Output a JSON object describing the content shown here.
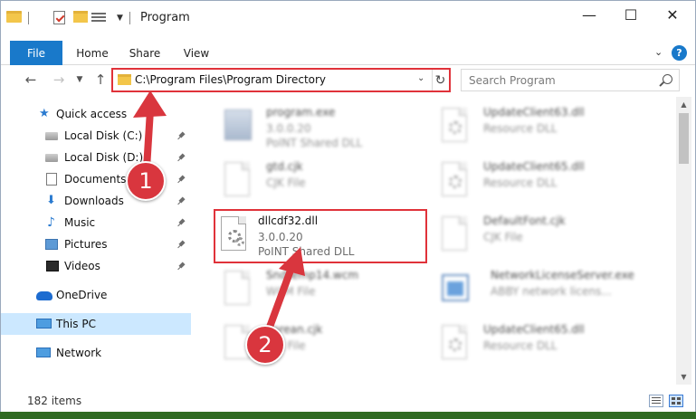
{
  "window": {
    "title": "Program",
    "controls": {
      "minimize": "—",
      "maximize": "☐",
      "close": "✕"
    }
  },
  "ribbon": {
    "tabs": [
      "File",
      "Home",
      "Share",
      "View"
    ],
    "help": "?"
  },
  "address": {
    "path": "C:\\Program Files\\Program Directory"
  },
  "search": {
    "placeholder": "Search Program"
  },
  "nav_pane": {
    "items": [
      {
        "label": "Quick access",
        "icon": "star-icon",
        "pinned": false
      },
      {
        "label": "Local Disk (C:)",
        "icon": "disk-icon",
        "pinned": true
      },
      {
        "label": "Local Disk (D:)",
        "icon": "disk-icon",
        "pinned": true
      },
      {
        "label": "Documents",
        "icon": "documents-icon",
        "pinned": true
      },
      {
        "label": "Downloads",
        "icon": "download-icon",
        "pinned": true
      },
      {
        "label": "Music",
        "icon": "music-icon",
        "pinned": true
      },
      {
        "label": "Pictures",
        "icon": "pictures-icon",
        "pinned": true
      },
      {
        "label": "Videos",
        "icon": "videos-icon",
        "pinned": true
      },
      {
        "label": "OneDrive",
        "icon": "onedrive-icon",
        "pinned": false
      },
      {
        "label": "This PC",
        "icon": "this-pc-icon",
        "pinned": false,
        "selected": true
      },
      {
        "label": "Network",
        "icon": "network-icon",
        "pinned": false
      }
    ]
  },
  "files": [
    {
      "name": "program.exe",
      "line2": "3.0.0.20",
      "line3": "PolNT Shared DLL",
      "icon": "application-icon",
      "blurred": true
    },
    {
      "name": "UpdateClient63.dll",
      "line2": "Resource DLL",
      "line3": "",
      "icon": "dll-file-icon",
      "blurred": true
    },
    {
      "name": "gtd.cjk",
      "line2": "CJK File",
      "line3": "",
      "icon": "blank-file-icon",
      "blurred": true
    },
    {
      "name": "UpdateClient65.dll",
      "line2": "Resource DLL",
      "line3": "",
      "icon": "dll-file-icon",
      "blurred": true
    },
    {
      "name": "dllcdf32.dll",
      "line2": "3.0.0.20",
      "line3": "PoINT Shared DLL",
      "icon": "dll-file-icon",
      "blurred": false,
      "highlighted": true
    },
    {
      "name": "DefaultFont.cjk",
      "line2": "CJK File",
      "line3": "",
      "icon": "blank-file-icon",
      "blurred": true
    },
    {
      "name": "SndTemp14.wcm",
      "line2": "WCM File",
      "line3": "",
      "icon": "blank-file-icon",
      "blurred": true
    },
    {
      "name": "NetworkLicenseServer.exe",
      "line2": "ABBY network licens...",
      "line3": "",
      "icon": "network-app-icon",
      "blurred": true
    },
    {
      "name": "Korean.cjk",
      "line2": "CJK File",
      "line3": "",
      "icon": "blank-file-icon",
      "blurred": true
    },
    {
      "name": "UpdateClient65.dll",
      "line2": "Resource DLL",
      "line3": "",
      "icon": "dll-file-icon",
      "blurred": true
    }
  ],
  "status": {
    "item_count": "182 items"
  },
  "callouts": [
    "1",
    "2"
  ],
  "colors": {
    "accent": "#1979ca",
    "highlight": "#e0323a",
    "selected_bg": "#cce8ff",
    "callout": "#d9363e"
  }
}
